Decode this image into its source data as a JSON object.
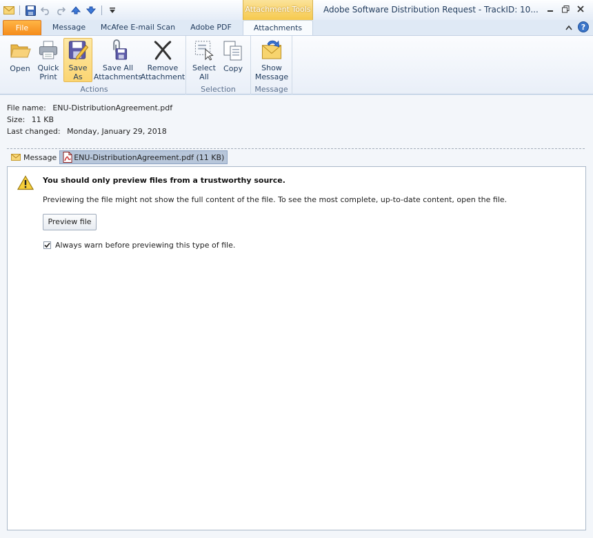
{
  "window": {
    "title": "Adobe Software Distribution Request - TrackID: 10...",
    "context_tab": "Attachment Tools"
  },
  "tabs": [
    {
      "label": "File"
    },
    {
      "label": "Message"
    },
    {
      "label": "McAfee E-mail Scan"
    },
    {
      "label": "Adobe PDF"
    },
    {
      "label": "Attachments"
    }
  ],
  "ribbon": {
    "groups": {
      "actions": "Actions",
      "selection": "Selection",
      "message": "Message"
    },
    "buttons": {
      "open": {
        "l1": "Open",
        "l2": ""
      },
      "quick_print": {
        "l1": "Quick",
        "l2": "Print"
      },
      "save_as": {
        "l1": "Save",
        "l2": "As"
      },
      "save_all": {
        "l1": "Save All",
        "l2": "Attachments"
      },
      "remove": {
        "l1": "Remove",
        "l2": "Attachment"
      },
      "select_all": {
        "l1": "Select",
        "l2": "All"
      },
      "copy": {
        "l1": "Copy",
        "l2": ""
      },
      "show_message": {
        "l1": "Show",
        "l2": "Message"
      }
    }
  },
  "file_info": {
    "name_label": "File name:",
    "name": "ENU-DistributionAgreement.pdf",
    "size_label": "Size:",
    "size": "11 KB",
    "changed_label": "Last changed:",
    "changed": "Monday, January 29, 2018"
  },
  "attachment_tabs": {
    "message": "Message",
    "attachment": "ENU-DistributionAgreement.pdf (11 KB)"
  },
  "preview": {
    "warning_title": "You should only preview files from a trustworthy source.",
    "warning_text": "Previewing the file might not show the full content of the file. To see the most complete, up-to-date content, open the file.",
    "button": "Preview file",
    "checkbox_label": "Always warn before previewing this type of file.",
    "checkbox_checked": "true"
  },
  "colors": {
    "file_tab": "#f58c1c",
    "context_tab": "#f6c94d",
    "selected_button": "#fbd572",
    "ribbon_bg": "#e9eff8"
  }
}
